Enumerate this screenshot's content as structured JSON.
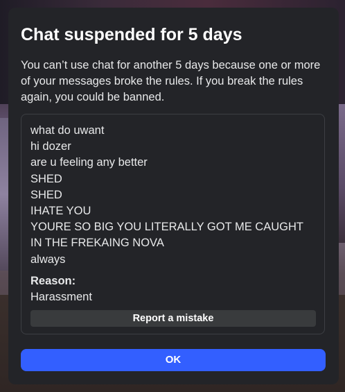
{
  "dialog": {
    "title": "Chat suspended for 5 days",
    "description": "You can’t use chat for another 5 days because one or more of your messages broke the rules. If you break the rules again, you could be banned.",
    "messages": [
      "what do uwant",
      "hi dozer",
      "are u feeling any better",
      "SHED",
      "SHED",
      "IHATE YOU",
      "YOURE SO BIG YOU LITERALLY GOT ME CAUGHT IN THE FREKAING NOVA",
      "always"
    ],
    "reason_label": "Reason:",
    "reason_value": "Harassment",
    "report_button_label": "Report a mistake",
    "ok_button_label": "OK"
  },
  "colors": {
    "dialog_background": "#232428",
    "primary_button": "#335fff",
    "secondary_button": "#393b3d",
    "text": "#e8e9ea"
  }
}
